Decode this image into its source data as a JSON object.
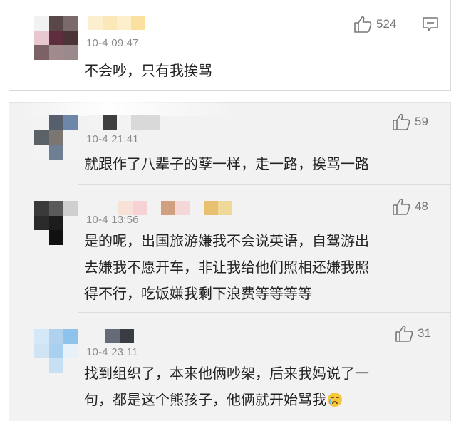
{
  "comments": [
    {
      "time": "10-4 09:47",
      "likes": "524",
      "text_lines": [
        "不会吵，只有我挨骂"
      ],
      "avatar_colors": [
        "#f2f2f2",
        "#5a4848",
        "#7b6a6a",
        "#e8c8ce",
        "#5e2e3e",
        "#4a3436",
        "#7c6264",
        "#a08a8c",
        "#9a8a8c"
      ],
      "name_colors": [
        "#fcefd0",
        "#fbe7b8",
        "#fdeecc",
        "#fbe0a0"
      ]
    },
    {
      "time": "10-4 21:41",
      "likes": "59",
      "text_lines": [
        "就跟作了八辈子的孽一样，走一路，挨骂一路"
      ],
      "avatar_colors": [
        "#f3f3f3",
        "#575e6c",
        "#6e86a8",
        "#5a6268",
        "#7c7670",
        "#f3f3f3",
        "#f3f3f3",
        "#6e7f94",
        "#f3f3f3"
      ],
      "name_colors": [
        "#f3f3f3",
        "#3f3f3f",
        "#f3f3f3",
        "#d9d9d9",
        "#d9d9d9"
      ]
    },
    {
      "time": "10-4 13:56",
      "likes": "48",
      "text_lines": [
        "是的呢，出国旅游嫌我不会说英语，自驾游出",
        "去嫌我不愿开车，非让我给他们照相还嫌我照",
        "得不行，吃饭嫌我剩下浪费等等等等"
      ],
      "avatar_colors": [
        "#3a3a3a",
        "#5a5a5a",
        "#cfcfcf",
        "#2a2a2a",
        "#1c1c1c",
        "#f2f2f2",
        "#f2f2f2",
        "#111111",
        "#f2f2f2"
      ],
      "name_colors": [
        "#f8e2d8",
        "#f6d2d6",
        "#f2f2f2",
        "#d2a080",
        "#f4d8d8",
        "#f2f2f2",
        "#e9c070",
        "#f0d898"
      ]
    },
    {
      "time": "10-4 23:11",
      "likes": "31",
      "text_lines": [
        "找到组织了，本来他俩吵架，后来我妈说了一",
        "句，都是这个熊孩子，他俩就开始骂我"
      ],
      "emoji": "crying-face",
      "avatar_colors": [
        "#d4e8f8",
        "#b0d2ee",
        "#8ec4ec",
        "#cfe4f4",
        "#a8d0f0",
        "#e6f1f8",
        "#f2f2f2",
        "#c8e0f4",
        "#f2f2f2"
      ],
      "name_colors": [
        "#666b78",
        "#3a3c44",
        "#f2f2f2",
        "#f2f2f2"
      ]
    }
  ]
}
